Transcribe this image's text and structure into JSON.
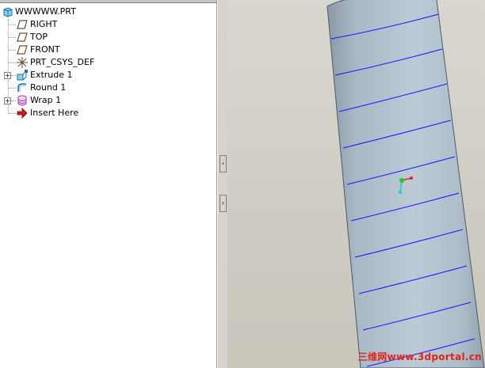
{
  "model_tree": {
    "root": {
      "label": "WWWWW.PRT",
      "icon": "part-icon"
    },
    "items": [
      {
        "label": "RIGHT",
        "icon": "datum-plane-icon",
        "expandable": false
      },
      {
        "label": "TOP",
        "icon": "datum-plane-icon",
        "expandable": false
      },
      {
        "label": "FRONT",
        "icon": "datum-plane-icon",
        "expandable": false
      },
      {
        "label": "PRT_CSYS_DEF",
        "icon": "coordinate-system-icon",
        "expandable": false
      },
      {
        "label": "Extrude 1",
        "icon": "extrude-icon",
        "expandable": true
      },
      {
        "label": "Round 1",
        "icon": "round-icon",
        "expandable": false
      },
      {
        "label": "Wrap 1",
        "icon": "wrap-icon",
        "expandable": true
      },
      {
        "label": "Insert Here",
        "icon": "insert-arrow-icon",
        "expandable": false
      }
    ]
  },
  "splitter": {
    "collapse_glyph": "‹",
    "expand_glyph": "›"
  },
  "viewport": {
    "model": "cylinder-with-wrapped-helix-curve",
    "colors": {
      "background": "#d4d2c9",
      "body": "#b3c2cd",
      "curve": "#1414ff",
      "csys_x": "#e0241c",
      "csys_y": "#22c832",
      "csys_z": "#22c8dc"
    }
  },
  "watermark": {
    "text": "三维网www.3dportal.cn",
    "color": "#e0241c"
  }
}
